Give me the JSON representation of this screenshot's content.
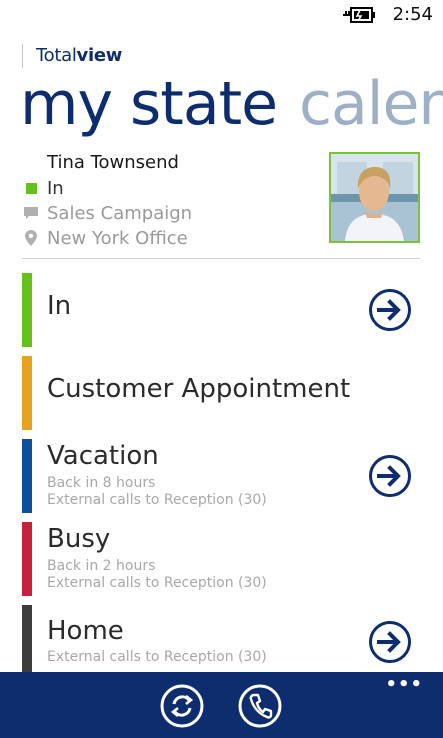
{
  "status_bar": {
    "time": "2:54",
    "battery_icon": "battery-charging-icon"
  },
  "app": {
    "logo_regular": "Total",
    "logo_bold": "view",
    "pivot": {
      "active": "my state",
      "next": "calend"
    }
  },
  "profile": {
    "name": "Tina Townsend",
    "state": "In",
    "state_color": "#67c11d",
    "campaign": "Sales Campaign",
    "location": "New York Office"
  },
  "states": [
    {
      "title": "In",
      "color": "#67c11d",
      "lines": [],
      "has_arrow": true
    },
    {
      "title": "Customer Appointment",
      "color": "#e8a21e",
      "lines": [],
      "has_arrow": false
    },
    {
      "title": "Vacation",
      "color": "#0e4f9c",
      "lines": [
        "Back in 8 hours",
        "External calls to Reception (30)"
      ],
      "has_arrow": true
    },
    {
      "title": "Busy",
      "color": "#c8203e",
      "lines": [
        "Back in 2 hours",
        "External calls to Reception (30)"
      ],
      "has_arrow": false
    },
    {
      "title": "Home",
      "color": "#3d3d3d",
      "lines": [
        "External calls to Reception (30)"
      ],
      "has_arrow": true
    }
  ],
  "app_bar": {
    "refresh_icon": "refresh-icon",
    "call_icon": "phone-icon",
    "more": "•••",
    "background": "#0e2d6e"
  }
}
